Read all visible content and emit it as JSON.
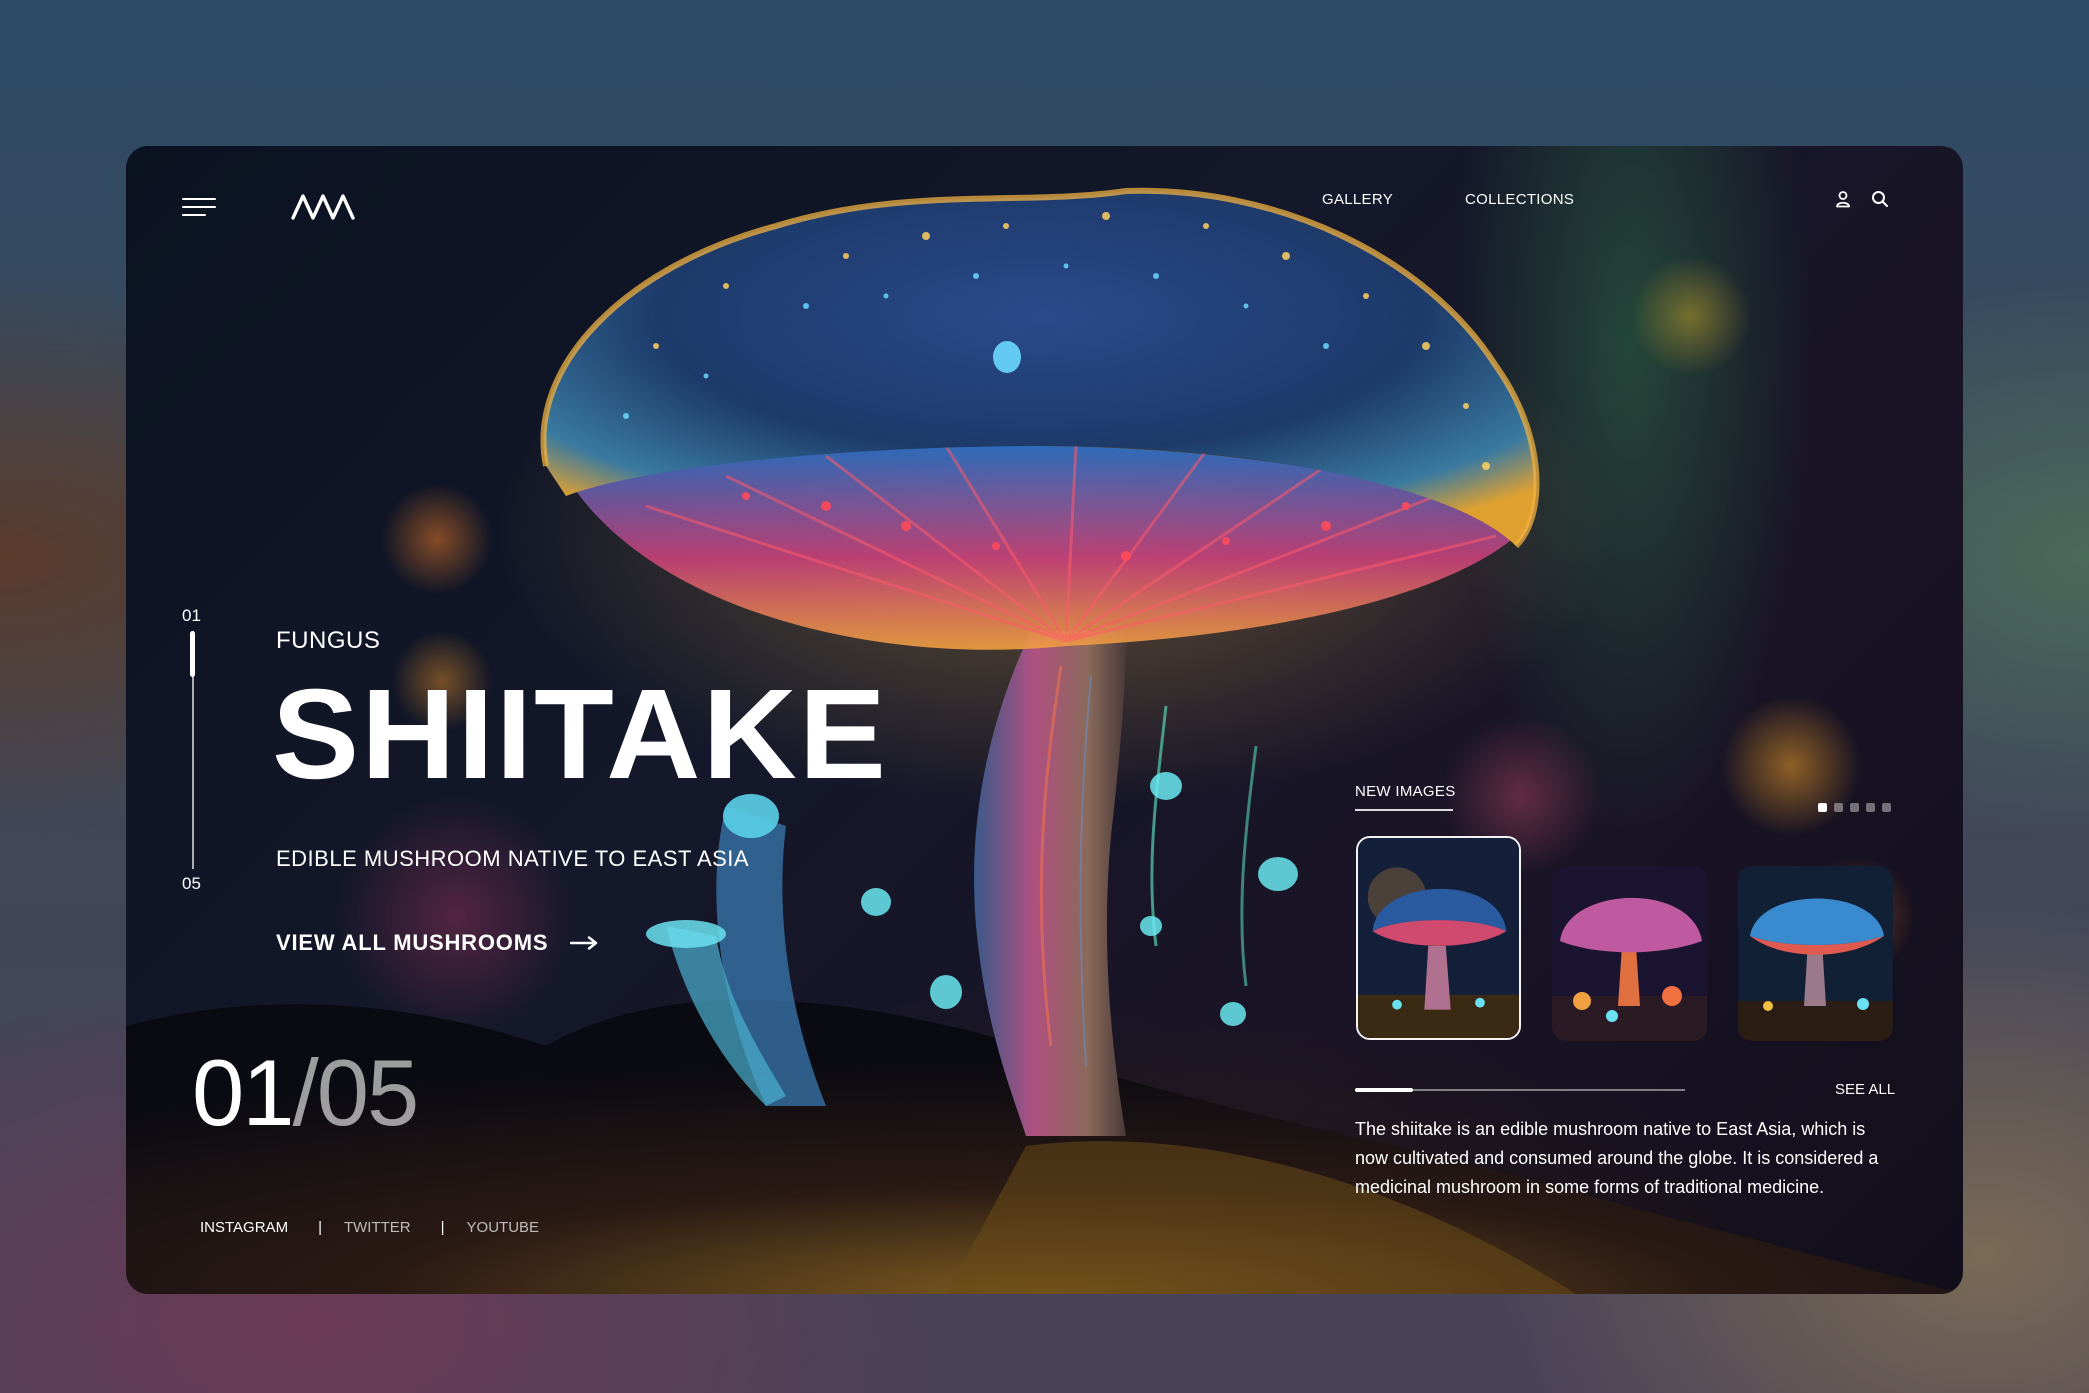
{
  "header": {
    "nav": [
      "GALLERY",
      "COLLECTIONS"
    ]
  },
  "slider": {
    "first": "01",
    "last": "05",
    "progress": 0.2
  },
  "hero": {
    "category": "FUNGUS",
    "title": "SHIITAKE",
    "subtitle": "EDIBLE MUSHROOM NATIVE TO EAST ASIA",
    "cta_label": "VIEW ALL MUSHROOMS"
  },
  "counter": {
    "current": "01",
    "separator": "/",
    "total": "05"
  },
  "social": [
    "INSTAGRAM",
    "TWITTER",
    "YOUTUBE"
  ],
  "gallery": {
    "label": "NEW IMAGES",
    "see_all": "SEE ALL",
    "dots_total": 5,
    "dots_active": 1,
    "progress": 0.18,
    "description": "The shiitake is an edible mushroom native to East Asia, which is now cultivated and consumed around the globe. It is considered a medicinal mushroom in some forms of traditional medicine."
  },
  "icons": [
    "menu-icon",
    "logo-icon",
    "user-icon",
    "search-icon",
    "arrow-right-icon"
  ],
  "colors": {
    "text": "#ffffff",
    "glow_blue": "#3fc8f0",
    "glow_orange": "#f0a030",
    "glow_pink": "#e0406a"
  }
}
